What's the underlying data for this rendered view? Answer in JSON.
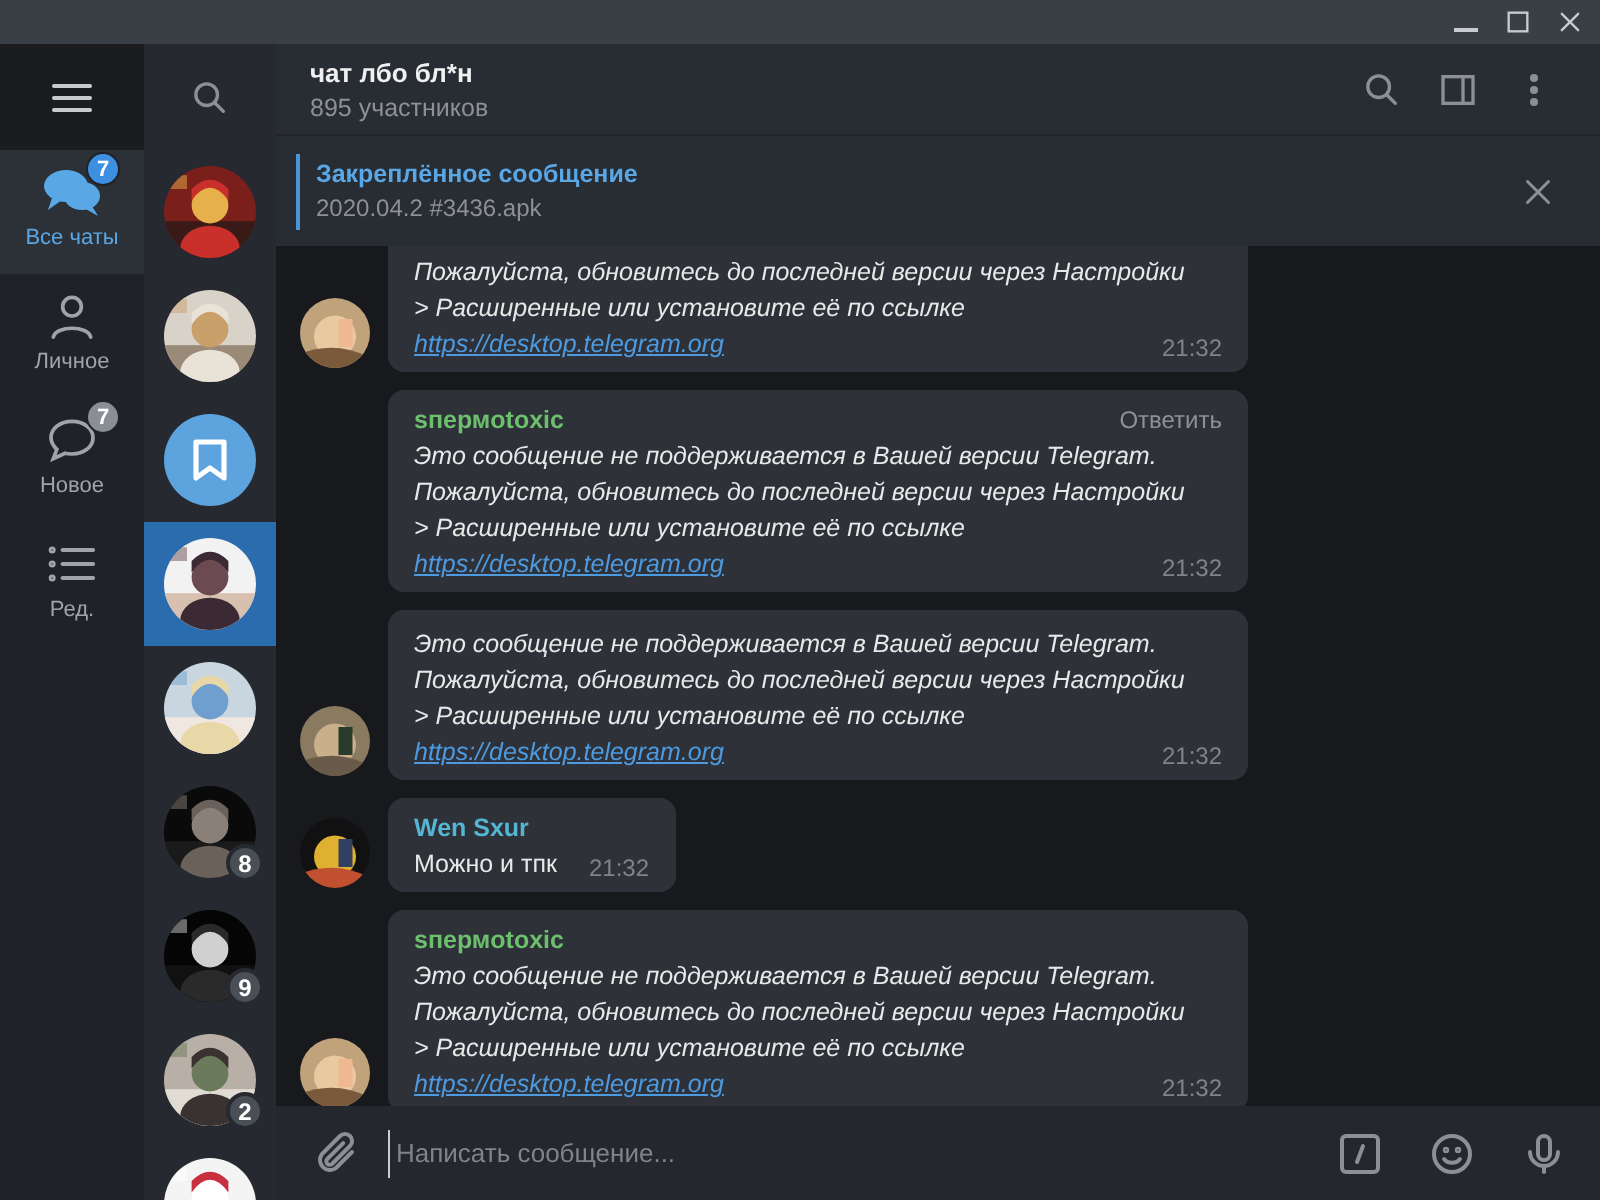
{
  "rail": {
    "items": [
      {
        "kind": "chats",
        "label": "Все чаты",
        "selected": true,
        "badge": "7"
      },
      {
        "kind": "personal",
        "label": "Личное",
        "selected": false
      },
      {
        "kind": "new",
        "label": "Новое",
        "selected": false,
        "badge": "7"
      },
      {
        "kind": "edit",
        "label": "Ред.",
        "selected": false
      }
    ]
  },
  "chats": [
    {
      "kind": "picture",
      "selected": false
    },
    {
      "kind": "picture",
      "selected": false
    },
    {
      "kind": "saved",
      "selected": false
    },
    {
      "kind": "picture",
      "selected": true
    },
    {
      "kind": "picture",
      "selected": false
    },
    {
      "kind": "picture",
      "selected": false,
      "badge": "8"
    },
    {
      "kind": "picture",
      "selected": false,
      "badge": "9"
    },
    {
      "kind": "picture",
      "selected": false,
      "badge": "2"
    },
    {
      "kind": "picture",
      "selected": false
    }
  ],
  "header": {
    "title": "чат лбо бл*н",
    "subtitle": "895 участников"
  },
  "pinned": {
    "label": "Закреплённое сообщение",
    "text": "2020.04.2 #3436.apk"
  },
  "messages": [
    {
      "kind": "unsupported",
      "avatar": true,
      "text": "Пожалуйста, обновитесь до последней версии через Настройки\n> Расширенные или установите её по ссылке",
      "link": "https://desktop.telegram.org",
      "time": "21:32"
    },
    {
      "kind": "unsupported",
      "avatar": false,
      "sender": "sпермotoxic",
      "color": "#6cbf6c",
      "reply": "Ответить",
      "text": "Это сообщение не поддерживается в Вашей версии Telegram.\nПожалуйста, обновитесь до последней версии через Настройки\n> Расширенные или установите её по ссылке",
      "link": "https://desktop.telegram.org",
      "time": "21:32"
    },
    {
      "kind": "unsupported",
      "avatar": true,
      "text": "Это сообщение не поддерживается в Вашей версии Telegram.\nПожалуйста, обновитесь до последней версии через Настройки\n> Расширенные или установите её по ссылке",
      "link": "https://desktop.telegram.org",
      "time": "21:32"
    },
    {
      "kind": "text",
      "avatar": true,
      "sender": "Wen Sxur",
      "color": "#55b6d4",
      "text": "Можно и тпк",
      "time": "21:32"
    },
    {
      "kind": "unsupported",
      "avatar": true,
      "sender": "sпермotoxic",
      "color": "#6cbf6c",
      "text": "Это сообщение не поддерживается в Вашей версии Telegram.\nПожалуйста, обновитесь до последней версии через Настройки\n> Расширенные или установите её по ссылке",
      "link": "https://desktop.telegram.org",
      "time": "21:32"
    }
  ],
  "composer": {
    "placeholder": "Написать сообщение..."
  }
}
